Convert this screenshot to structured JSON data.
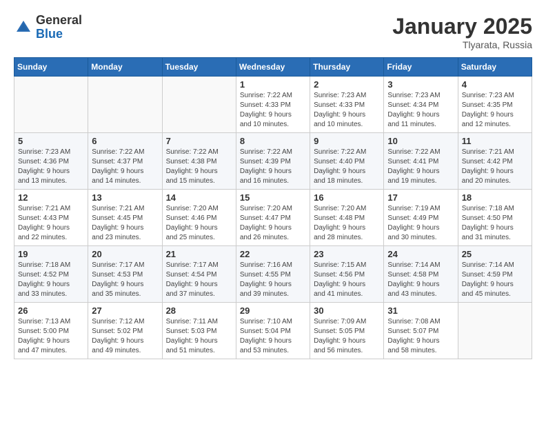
{
  "logo": {
    "general": "General",
    "blue": "Blue"
  },
  "title": "January 2025",
  "subtitle": "Tlyarata, Russia",
  "days_header": [
    "Sunday",
    "Monday",
    "Tuesday",
    "Wednesday",
    "Thursday",
    "Friday",
    "Saturday"
  ],
  "weeks": [
    {
      "cells": [
        {
          "day": null,
          "info": null
        },
        {
          "day": null,
          "info": null
        },
        {
          "day": null,
          "info": null
        },
        {
          "day": "1",
          "info": "Sunrise: 7:22 AM\nSunset: 4:33 PM\nDaylight: 9 hours\nand 10 minutes."
        },
        {
          "day": "2",
          "info": "Sunrise: 7:23 AM\nSunset: 4:33 PM\nDaylight: 9 hours\nand 10 minutes."
        },
        {
          "day": "3",
          "info": "Sunrise: 7:23 AM\nSunset: 4:34 PM\nDaylight: 9 hours\nand 11 minutes."
        },
        {
          "day": "4",
          "info": "Sunrise: 7:23 AM\nSunset: 4:35 PM\nDaylight: 9 hours\nand 12 minutes."
        }
      ]
    },
    {
      "cells": [
        {
          "day": "5",
          "info": "Sunrise: 7:23 AM\nSunset: 4:36 PM\nDaylight: 9 hours\nand 13 minutes."
        },
        {
          "day": "6",
          "info": "Sunrise: 7:22 AM\nSunset: 4:37 PM\nDaylight: 9 hours\nand 14 minutes."
        },
        {
          "day": "7",
          "info": "Sunrise: 7:22 AM\nSunset: 4:38 PM\nDaylight: 9 hours\nand 15 minutes."
        },
        {
          "day": "8",
          "info": "Sunrise: 7:22 AM\nSunset: 4:39 PM\nDaylight: 9 hours\nand 16 minutes."
        },
        {
          "day": "9",
          "info": "Sunrise: 7:22 AM\nSunset: 4:40 PM\nDaylight: 9 hours\nand 18 minutes."
        },
        {
          "day": "10",
          "info": "Sunrise: 7:22 AM\nSunset: 4:41 PM\nDaylight: 9 hours\nand 19 minutes."
        },
        {
          "day": "11",
          "info": "Sunrise: 7:21 AM\nSunset: 4:42 PM\nDaylight: 9 hours\nand 20 minutes."
        }
      ]
    },
    {
      "cells": [
        {
          "day": "12",
          "info": "Sunrise: 7:21 AM\nSunset: 4:43 PM\nDaylight: 9 hours\nand 22 minutes."
        },
        {
          "day": "13",
          "info": "Sunrise: 7:21 AM\nSunset: 4:45 PM\nDaylight: 9 hours\nand 23 minutes."
        },
        {
          "day": "14",
          "info": "Sunrise: 7:20 AM\nSunset: 4:46 PM\nDaylight: 9 hours\nand 25 minutes."
        },
        {
          "day": "15",
          "info": "Sunrise: 7:20 AM\nSunset: 4:47 PM\nDaylight: 9 hours\nand 26 minutes."
        },
        {
          "day": "16",
          "info": "Sunrise: 7:20 AM\nSunset: 4:48 PM\nDaylight: 9 hours\nand 28 minutes."
        },
        {
          "day": "17",
          "info": "Sunrise: 7:19 AM\nSunset: 4:49 PM\nDaylight: 9 hours\nand 30 minutes."
        },
        {
          "day": "18",
          "info": "Sunrise: 7:18 AM\nSunset: 4:50 PM\nDaylight: 9 hours\nand 31 minutes."
        }
      ]
    },
    {
      "cells": [
        {
          "day": "19",
          "info": "Sunrise: 7:18 AM\nSunset: 4:52 PM\nDaylight: 9 hours\nand 33 minutes."
        },
        {
          "day": "20",
          "info": "Sunrise: 7:17 AM\nSunset: 4:53 PM\nDaylight: 9 hours\nand 35 minutes."
        },
        {
          "day": "21",
          "info": "Sunrise: 7:17 AM\nSunset: 4:54 PM\nDaylight: 9 hours\nand 37 minutes."
        },
        {
          "day": "22",
          "info": "Sunrise: 7:16 AM\nSunset: 4:55 PM\nDaylight: 9 hours\nand 39 minutes."
        },
        {
          "day": "23",
          "info": "Sunrise: 7:15 AM\nSunset: 4:56 PM\nDaylight: 9 hours\nand 41 minutes."
        },
        {
          "day": "24",
          "info": "Sunrise: 7:14 AM\nSunset: 4:58 PM\nDaylight: 9 hours\nand 43 minutes."
        },
        {
          "day": "25",
          "info": "Sunrise: 7:14 AM\nSunset: 4:59 PM\nDaylight: 9 hours\nand 45 minutes."
        }
      ]
    },
    {
      "cells": [
        {
          "day": "26",
          "info": "Sunrise: 7:13 AM\nSunset: 5:00 PM\nDaylight: 9 hours\nand 47 minutes."
        },
        {
          "day": "27",
          "info": "Sunrise: 7:12 AM\nSunset: 5:02 PM\nDaylight: 9 hours\nand 49 minutes."
        },
        {
          "day": "28",
          "info": "Sunrise: 7:11 AM\nSunset: 5:03 PM\nDaylight: 9 hours\nand 51 minutes."
        },
        {
          "day": "29",
          "info": "Sunrise: 7:10 AM\nSunset: 5:04 PM\nDaylight: 9 hours\nand 53 minutes."
        },
        {
          "day": "30",
          "info": "Sunrise: 7:09 AM\nSunset: 5:05 PM\nDaylight: 9 hours\nand 56 minutes."
        },
        {
          "day": "31",
          "info": "Sunrise: 7:08 AM\nSunset: 5:07 PM\nDaylight: 9 hours\nand 58 minutes."
        },
        {
          "day": null,
          "info": null
        }
      ]
    }
  ]
}
